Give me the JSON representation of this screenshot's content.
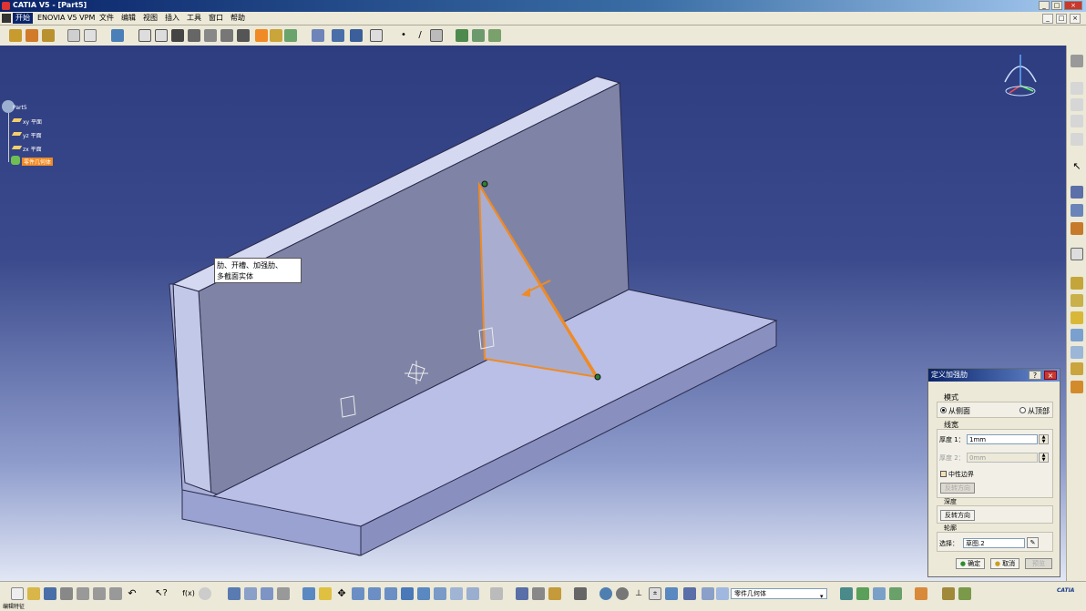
{
  "window": {
    "title": "CATIA V5 - [Part5]",
    "minimize": "_",
    "maximize": "□",
    "close": "×"
  },
  "menu": {
    "items": [
      "开始",
      "ENOVIA V5 VPM",
      "文件",
      "编辑",
      "视图",
      "插入",
      "工具",
      "窗口",
      "帮助"
    ],
    "active_index": 0
  },
  "spec_tree": {
    "root": "Part5",
    "items": [
      "xy 平面",
      "yz 平面",
      "zx 平面"
    ],
    "selected": "零件几何体"
  },
  "tooltip": {
    "line1": "肋、开槽、加强肋、",
    "line2": "多截面实体"
  },
  "dialog": {
    "title": "定义加强肋",
    "help": "?",
    "close": "×",
    "mode_label": "模式",
    "from_side": "从侧面",
    "from_top": "从顶部",
    "thickness_label": "线宽",
    "thickness1_label": "厚度 1：",
    "thickness1_value": "1mm",
    "thickness2_label": "厚度 2：",
    "thickness2_value": "0mm",
    "neutral_label": "中性边界",
    "reverse_dir_btn": "反转方向",
    "depth_label": "深度",
    "depth_reverse_btn": "反转方向",
    "profile_label": "轮廓",
    "selection_label": "选择：",
    "selection_value": "草图.2",
    "ok": "确定",
    "cancel": "取消",
    "preview": "预览"
  },
  "bottom_toolbar": {
    "body_combo": "零件几何体"
  },
  "status": {
    "text": "编辑特征"
  },
  "compass_logo": "CATIA",
  "colors": {
    "accent": "#f08a24",
    "title_blue": "#0a246a",
    "model_face": "#b9bfe6"
  }
}
